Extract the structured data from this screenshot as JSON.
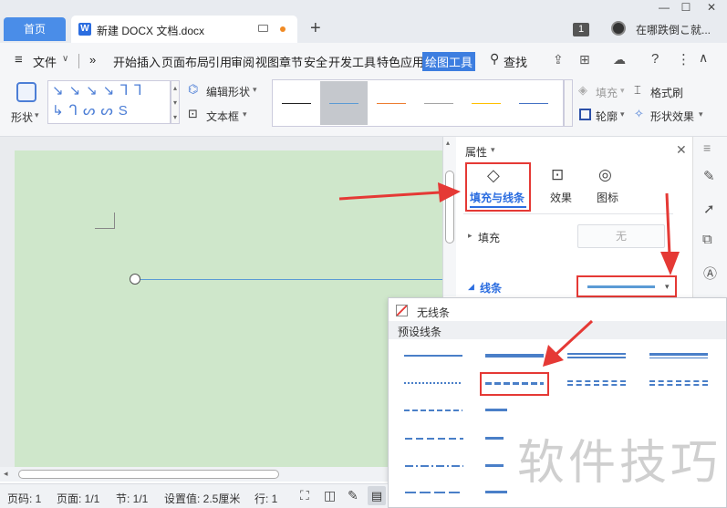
{
  "tabs": {
    "home": "首页",
    "doc": "新建 DOCX 文档.docx"
  },
  "titlebar": {
    "badge": "1",
    "user": "在哪跌倒こ就...",
    "min": "—",
    "max": "☐",
    "close": "✕"
  },
  "menu": {
    "file": "文件",
    "more": "»",
    "items": [
      "开始",
      "插入",
      "页面布局",
      "引用",
      "审阅",
      "视图",
      "章节",
      "安全",
      "开发工具",
      "特色应用"
    ],
    "active": "绘图工具",
    "search": "查找"
  },
  "ribbon": {
    "shape": "形状",
    "edit_shape": "编辑形状",
    "textbox": "文本框",
    "fill": "填充",
    "format_brush": "格式刷",
    "outline": "轮廓",
    "shape_effect": "形状效果",
    "style_colors": [
      "#222222",
      "#5b9bd5",
      "#ed7d31",
      "#a5a5a5",
      "#ffc000",
      "#4472c4"
    ]
  },
  "panel": {
    "title": "属性",
    "tabs": [
      "填充与线条",
      "效果",
      "图标"
    ],
    "fill_label": "填充",
    "fill_value": "无",
    "line_label": "线条"
  },
  "popup": {
    "no_line": "无线条",
    "preset": "预设线条"
  },
  "status": {
    "page": "页码: 1",
    "pages": "页面: 1/1",
    "section": "节: 1/1",
    "setting": "设置值: 2.5厘米",
    "row": "行: 1"
  },
  "watermark": "软件技巧",
  "colors": {
    "accent": "#4a8de8",
    "highlight": "#e53935",
    "page": "#cfe7cb"
  }
}
